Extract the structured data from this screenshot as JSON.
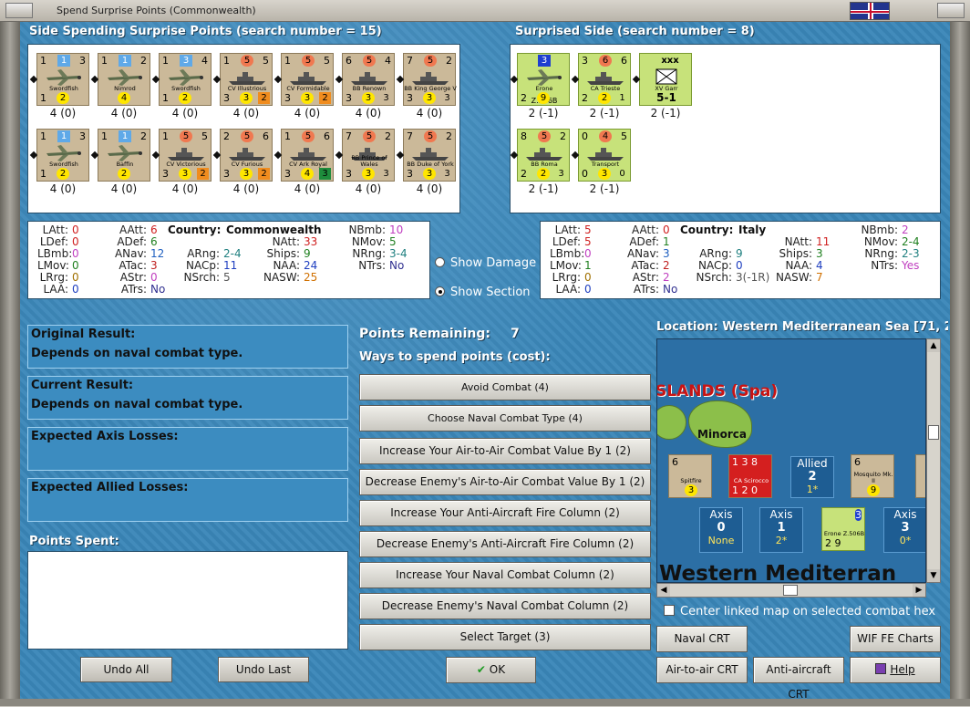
{
  "window": {
    "title": "Spend Surprise Points (Commonwealth)",
    "flag": "union-jack"
  },
  "spending_side": {
    "header": "Side Spending Surprise Points (search number = 15)",
    "units": [
      {
        "tl": "1",
        "tc": "1",
        "tr": "3",
        "name": "Swordfish",
        "bl": "1",
        "bc": "2",
        "br": "",
        "icon": "aircraft",
        "under": "4 (0)"
      },
      {
        "tl": "1",
        "tc": "1",
        "tr": "2",
        "name": "Nimrod",
        "bl": "",
        "bc": "4",
        "br": "",
        "icon": "aircraft",
        "under": "4 (0)"
      },
      {
        "tl": "1",
        "tc": "3",
        "tr": "4",
        "name": "Swordfish",
        "bl": "1",
        "bc": "2",
        "br": "",
        "icon": "aircraft",
        "under": "4 (0)"
      },
      {
        "tl": "1",
        "tc": "5",
        "tr": "5",
        "name": "CV Illustrious",
        "bl": "3",
        "bc": "3",
        "br": "2",
        "icon": "ship",
        "under": "4 (0)"
      },
      {
        "tl": "1",
        "tc": "5",
        "tr": "5",
        "name": "CV Formidable",
        "bl": "3",
        "bc": "3",
        "br": "2",
        "icon": "ship",
        "under": "4 (0)"
      },
      {
        "tl": "6",
        "tc": "5",
        "tr": "4",
        "name": "BB Renown",
        "bl": "3",
        "bc": "3",
        "br": "3",
        "icon": "ship",
        "under": "4 (0)"
      },
      {
        "tl": "7",
        "tc": "5",
        "tr": "2",
        "name": "BB King George V",
        "bl": "3",
        "bc": "3",
        "br": "3",
        "icon": "ship",
        "under": "4 (0)"
      },
      {
        "tl": "1",
        "tc": "1",
        "tr": "3",
        "name": "Swordfish",
        "bl": "1",
        "bc": "2",
        "br": "",
        "icon": "aircraft",
        "under": "4 (0)"
      },
      {
        "tl": "1",
        "tc": "1",
        "tr": "2",
        "name": "Baffin",
        "bl": "",
        "bc": "2",
        "br": "",
        "icon": "aircraft",
        "under": "4 (0)"
      },
      {
        "tl": "1",
        "tc": "5",
        "tr": "5",
        "name": "CV Victorious",
        "bl": "3",
        "bc": "3",
        "br": "2",
        "icon": "ship",
        "under": "4 (0)"
      },
      {
        "tl": "2",
        "tc": "5",
        "tr": "6",
        "name": "CV Furious",
        "bl": "3",
        "bc": "3",
        "br": "2",
        "icon": "ship",
        "under": "4 (0)"
      },
      {
        "tl": "1",
        "tc": "5",
        "tr": "6",
        "name": "CV Ark Royal",
        "bl": "3",
        "bc": "4",
        "br": "3",
        "icon": "ship",
        "under": "4 (0)"
      },
      {
        "tl": "7",
        "tc": "5",
        "tr": "2",
        "name": "BB Prince of Wales",
        "bl": "3",
        "bc": "3",
        "br": "3",
        "icon": "ship",
        "under": "4 (0)"
      },
      {
        "tl": "7",
        "tc": "5",
        "tr": "2",
        "name": "BB Duke of York",
        "bl": "3",
        "bc": "3",
        "br": "3",
        "icon": "ship",
        "under": "4 (0)"
      }
    ]
  },
  "surprised_side": {
    "header": "Surprised Side (search number = 8)",
    "units": [
      {
        "tl": "",
        "tc": "3",
        "tr": "",
        "name": "Erone",
        "sub": "Z.506B",
        "bl": "2",
        "bc": "9",
        "br": "",
        "icon": "aircraft",
        "under": "2 (-1)"
      },
      {
        "tl": "3",
        "tc": "6",
        "tr": "6",
        "name": "CA Trieste",
        "bl": "2",
        "bc": "2",
        "br": "1",
        "icon": "ship",
        "under": "2 (-1)"
      },
      {
        "tl": "",
        "tc": "xxx",
        "tr": "",
        "name": "XV Garr",
        "bl": "",
        "bc": "5-1",
        "br": "",
        "icon": "garrison",
        "under": "2 (-1)"
      },
      {
        "tl": "8",
        "tc": "5",
        "tr": "2",
        "name": "BB Roma",
        "bl": "2",
        "bc": "2",
        "br": "3",
        "icon": "ship",
        "under": "2 (-1)"
      },
      {
        "tl": "0",
        "tc": "4",
        "tr": "5",
        "name": "Transport",
        "bl": "0",
        "bc": "3",
        "br": "0",
        "icon": "ship",
        "under": "2 (-1)"
      }
    ]
  },
  "stats_left": {
    "country_label": "Country:",
    "country": "Commonwealth",
    "rows": [
      {
        "label": "LAtt:",
        "value": "0",
        "color": "#d02020"
      },
      {
        "label": "LDef:",
        "value": "0",
        "color": "#d02020"
      },
      {
        "label": "LBmb:",
        "value": "0",
        "color": "#c040c0"
      },
      {
        "label": "LMov:",
        "value": "0",
        "color": "#208020"
      },
      {
        "label": "LRrg:",
        "value": "0",
        "color": "#a07000"
      },
      {
        "label": "LAA:",
        "value": "0",
        "color": "#2040c0"
      }
    ],
    "col2": [
      {
        "label": "AAtt:",
        "value": "6",
        "color": "#d02020"
      },
      {
        "label": "ADef:",
        "value": "6",
        "color": "#208020"
      },
      {
        "label": "ANav:",
        "value": "12",
        "color": "#2060c0"
      },
      {
        "label": "ATac:",
        "value": "3",
        "color": "#c02020"
      },
      {
        "label": "AStr:",
        "value": "0",
        "color": "#c040c0"
      },
      {
        "label": "ATrs:",
        "value": "No",
        "color": "#303090"
      }
    ],
    "col3": [
      {
        "label": "ARng:",
        "value": "2-4",
        "color": "#208080"
      },
      {
        "label": "NACp:",
        "value": "11",
        "color": "#2040c0"
      },
      {
        "label": "NSrch:",
        "value": "5",
        "color": "#555"
      }
    ],
    "col4": [
      {
        "label": "NAtt:",
        "value": "33",
        "color": "#d02020"
      },
      {
        "label": "Ships:",
        "value": "9",
        "color": "#208020"
      },
      {
        "label": "NAA:",
        "value": "24",
        "color": "#2040c0"
      },
      {
        "label": "NASW:",
        "value": "25",
        "color": "#d07000"
      }
    ],
    "col5": [
      {
        "label": "NBmb:",
        "value": "10",
        "color": "#c040c0"
      },
      {
        "label": "NMov:",
        "value": "5",
        "color": "#208020"
      },
      {
        "label": "NRng:",
        "value": "3-4",
        "color": "#208080"
      },
      {
        "label": "NTrs:",
        "value": "No",
        "color": "#303090"
      }
    ]
  },
  "stats_right": {
    "country_label": "Country:",
    "country": "Italy",
    "rows": [
      {
        "label": "LAtt:",
        "value": "5",
        "color": "#d02020"
      },
      {
        "label": "LDef:",
        "value": "5",
        "color": "#d02020"
      },
      {
        "label": "LBmb:",
        "value": "0",
        "color": "#c040c0"
      },
      {
        "label": "LMov:",
        "value": "1",
        "color": "#208020"
      },
      {
        "label": "LRrg:",
        "value": "0",
        "color": "#a07000"
      },
      {
        "label": "LAA:",
        "value": "0",
        "color": "#2040c0"
      }
    ],
    "col2": [
      {
        "label": "AAtt:",
        "value": "0",
        "color": "#d02020"
      },
      {
        "label": "ADef:",
        "value": "1",
        "color": "#208020"
      },
      {
        "label": "ANav:",
        "value": "3",
        "color": "#2060c0"
      },
      {
        "label": "ATac:",
        "value": "2",
        "color": "#c02020"
      },
      {
        "label": "AStr:",
        "value": "2",
        "color": "#c040c0"
      },
      {
        "label": "ATrs:",
        "value": "No",
        "color": "#303090"
      }
    ],
    "col3": [
      {
        "label": "ARng:",
        "value": "9",
        "color": "#208080"
      },
      {
        "label": "NACp:",
        "value": "0",
        "color": "#2040c0"
      },
      {
        "label": "NSrch:",
        "value": "3(-1R)",
        "color": "#555"
      }
    ],
    "col4": [
      {
        "label": "NAtt:",
        "value": "11",
        "color": "#d02020"
      },
      {
        "label": "Ships:",
        "value": "3",
        "color": "#208020"
      },
      {
        "label": "NAA:",
        "value": "4",
        "color": "#2040c0"
      },
      {
        "label": "NASW:",
        "value": "7",
        "color": "#d07000"
      }
    ],
    "col5": [
      {
        "label": "NBmb:",
        "value": "2",
        "color": "#c040c0"
      },
      {
        "label": "NMov:",
        "value": "2-4",
        "color": "#208020"
      },
      {
        "label": "NRng:",
        "value": "2-3",
        "color": "#208080"
      },
      {
        "label": "NTrs:",
        "value": "Yes",
        "color": "#c040c0"
      }
    ]
  },
  "view_options": {
    "show_damage": "Show Damage",
    "show_section": "Show Section",
    "selected": "show_section"
  },
  "results": {
    "original_title": "Original Result:",
    "original_value": "Depends on naval combat type.",
    "current_title": "Current Result:",
    "current_value": "Depends on naval combat type.",
    "axis_losses_title": "Expected Axis Losses:",
    "allied_losses_title": "Expected Allied Losses:",
    "points_spent_title": "Points Spent:"
  },
  "points": {
    "label": "Points Remaining:",
    "value": "7",
    "ways_label": "Ways to spend points (cost):"
  },
  "options": [
    "Avoid Combat (4)",
    "Choose Naval Combat Type (4)",
    "Increase Your Air-to-Air Combat Value By 1 (2)",
    "Decrease Enemy's Air-to-Air Combat Value By 1 (2)",
    "Increase Your Anti-Aircraft Fire Column (2)",
    "Decrease Enemy's Anti-Aircraft Fire Column (2)",
    "Increase Your Naval Combat Column (2)",
    "Decrease Enemy's Naval Combat Column (2)",
    "Select Target (3)"
  ],
  "location": {
    "label": "Location: Western Mediterranean Sea [71, 2",
    "islands_label": "SLANDS (Spa)",
    "minorca": "Minorca",
    "sea_label": "Western Mediterran",
    "allied_box": {
      "title": "Allied",
      "value": "2",
      "sub": "1*"
    },
    "axis_boxes": [
      {
        "title": "Axis",
        "value": "0",
        "sub": "None"
      },
      {
        "title": "Axis",
        "value": "1",
        "sub": "2*"
      },
      {
        "title": "Axis",
        "value": "3",
        "sub": "0*"
      }
    ],
    "map_counters": [
      {
        "label": "Spitfire",
        "top": "6",
        "mid": "2",
        "bot": "3"
      },
      {
        "label": "CA Scirocco",
        "top": "1 3 8",
        "mid": "",
        "bot": "1 2 0"
      },
      {
        "label": "Mosquito Mk. II",
        "top": "6",
        "mid": "2",
        "bot": "9"
      },
      {
        "label": "Erone Z.506B",
        "top": "3",
        "mid": "8",
        "bot": "2 9"
      }
    ]
  },
  "checkbox": {
    "label": "Center linked map on selected combat hex",
    "checked": false
  },
  "buttons": {
    "undo_all": "Undo All",
    "undo_last": "Undo Last",
    "ok": "OK",
    "naval_crt": "Naval CRT",
    "wif_charts": "WIF FE Charts",
    "air_crt": "Air-to-air CRT",
    "aa_crt": "Anti-aircraft CRT",
    "help": "Help"
  }
}
